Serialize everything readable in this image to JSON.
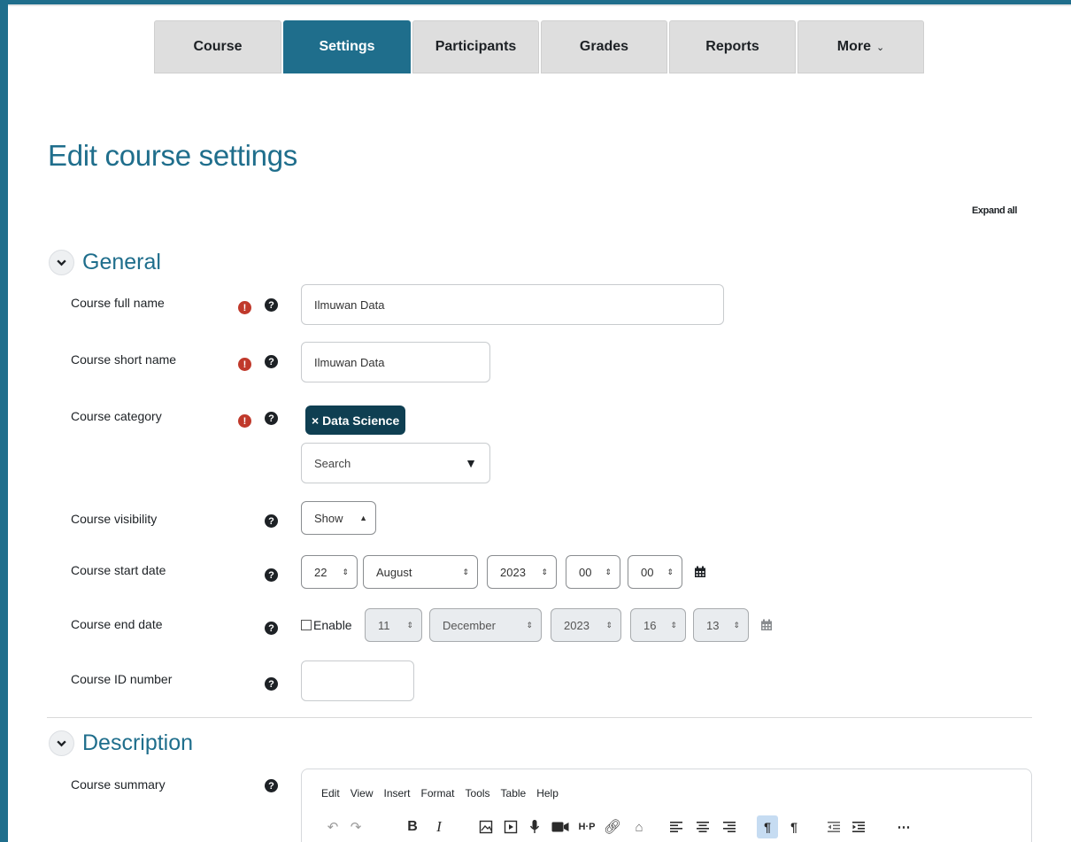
{
  "nav": {
    "tabs": [
      {
        "label": "Course"
      },
      {
        "label": "Settings"
      },
      {
        "label": "Participants"
      },
      {
        "label": "Grades"
      },
      {
        "label": "Reports"
      },
      {
        "label": "More"
      }
    ]
  },
  "page": {
    "title": "Edit course settings",
    "expand_all": "Expand all"
  },
  "general": {
    "title": "General",
    "full_name": {
      "label": "Course full name",
      "value": "Ilmuwan Data"
    },
    "short_name": {
      "label": "Course short name",
      "value": "Ilmuwan Data"
    },
    "category": {
      "label": "Course category",
      "chip": "× Data Science",
      "search_placeholder": "Search"
    },
    "visibility": {
      "label": "Course visibility",
      "value": "Show"
    },
    "start_date": {
      "label": "Course start date",
      "day": "22",
      "month": "August",
      "year": "2023",
      "hour": "00",
      "minute": "00"
    },
    "end_date": {
      "label": "Course end date",
      "enable": "Enable",
      "day": "11",
      "month": "December",
      "year": "2023",
      "hour": "16",
      "minute": "13"
    },
    "id_number": {
      "label": "Course ID number",
      "value": ""
    }
  },
  "description": {
    "title": "Description",
    "summary_label": "Course summary",
    "menubar": [
      "Edit",
      "View",
      "Insert",
      "Format",
      "Tools",
      "Table",
      "Help"
    ]
  },
  "colors": {
    "accent": "#1f6e8c",
    "required": "#c0392b",
    "chip": "#0f3f52"
  }
}
